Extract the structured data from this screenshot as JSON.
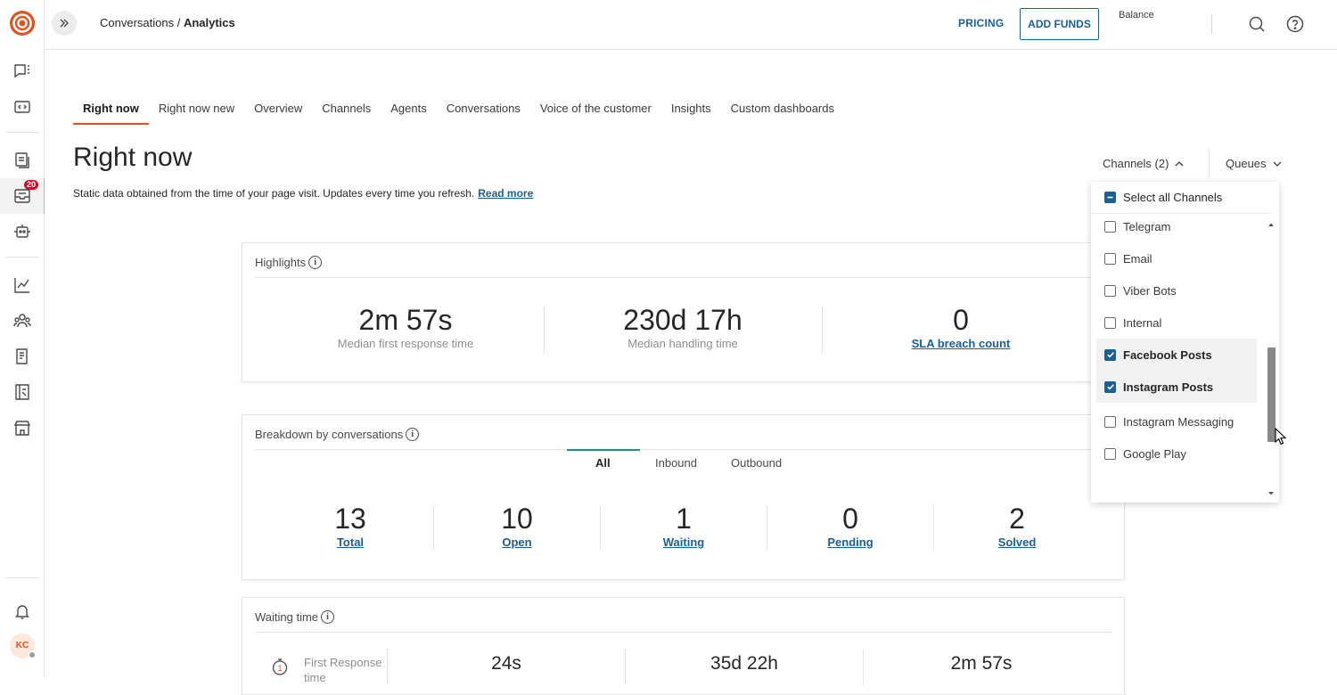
{
  "app": {
    "breadcrumb": {
      "parent": "Conversations",
      "separator": " / ",
      "current": "Analytics"
    },
    "badge_count": "20",
    "user_initials": "KC",
    "accent_color": "#e0531f",
    "link_color": "#1b5f95"
  },
  "header": {
    "pricing_label": "PRICING",
    "add_funds_label": "ADD FUNDS",
    "balance_label": "Balance"
  },
  "tabs": [
    {
      "label": "Right now"
    },
    {
      "label": "Right now new"
    },
    {
      "label": "Overview"
    },
    {
      "label": "Channels"
    },
    {
      "label": "Agents"
    },
    {
      "label": "Conversations"
    },
    {
      "label": "Voice of the customer"
    },
    {
      "label": "Insights"
    },
    {
      "label": "Custom dashboards"
    }
  ],
  "page": {
    "title": "Right now",
    "subtitle": "Static data obtained from the time of your page visit. Updates every time you refresh.",
    "read_more": "Read more"
  },
  "filters": {
    "channels_label": "Channels (2)",
    "queues_label": "Queues"
  },
  "highlights": {
    "title": "Highlights",
    "metrics": [
      {
        "value": "2m 57s",
        "label": "Median first response time"
      },
      {
        "value": "230d 17h",
        "label": "Median handling time"
      },
      {
        "value": "0",
        "label": "SLA breach count"
      }
    ]
  },
  "breakdown": {
    "title": "Breakdown by conversations",
    "tabs": [
      "All",
      "Inbound",
      "Outbound"
    ],
    "metrics": [
      {
        "value": "13",
        "label": "Total"
      },
      {
        "value": "10",
        "label": "Open"
      },
      {
        "value": "1",
        "label": "Waiting"
      },
      {
        "value": "0",
        "label": "Pending"
      },
      {
        "value": "2",
        "label": "Solved"
      }
    ]
  },
  "waiting": {
    "title": "Waiting time",
    "row_label": "First Response time",
    "values": [
      "24s",
      "35d 22h",
      "2m 57s"
    ]
  },
  "channel_dropdown": {
    "select_all": "Select all Channels",
    "items": [
      {
        "label": "Telegram",
        "checked": false
      },
      {
        "label": "Email",
        "checked": false
      },
      {
        "label": "Viber Bots",
        "checked": false
      },
      {
        "label": "Internal",
        "checked": false
      },
      {
        "label": "Facebook Posts",
        "checked": true
      },
      {
        "label": "Instagram Posts",
        "checked": true
      },
      {
        "label": "Instagram Messaging",
        "checked": false
      },
      {
        "label": "Google Play",
        "checked": false
      }
    ]
  }
}
